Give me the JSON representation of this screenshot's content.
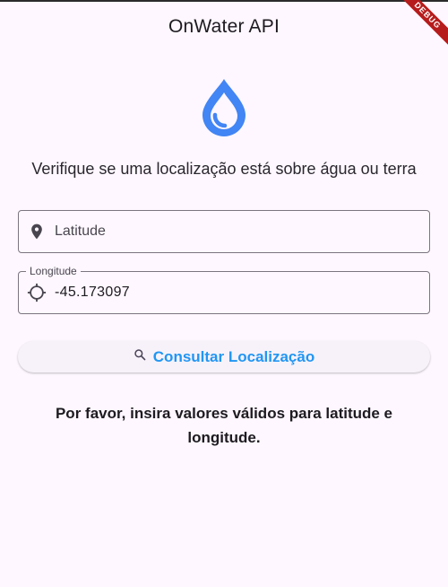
{
  "app_bar": {
    "title": "OnWater API"
  },
  "debug_banner": {
    "label": "DEBUG"
  },
  "header": {
    "icon": "water-drop-icon",
    "icon_color": "#4285f4",
    "subtitle": "Verifique se uma localização está sobre água ou terra"
  },
  "form": {
    "latitude": {
      "label": "Latitude",
      "value": "",
      "icon": "location-pin-icon"
    },
    "longitude": {
      "label": "Longitude",
      "value": "-45.173097",
      "icon": "gps-crosshair-icon"
    }
  },
  "actions": {
    "consult_label": "Consultar Localização",
    "consult_icon": "search-icon",
    "accent": "#2196f3"
  },
  "result": {
    "message": "Por favor, insira valores válidos para latitude e longitude."
  }
}
